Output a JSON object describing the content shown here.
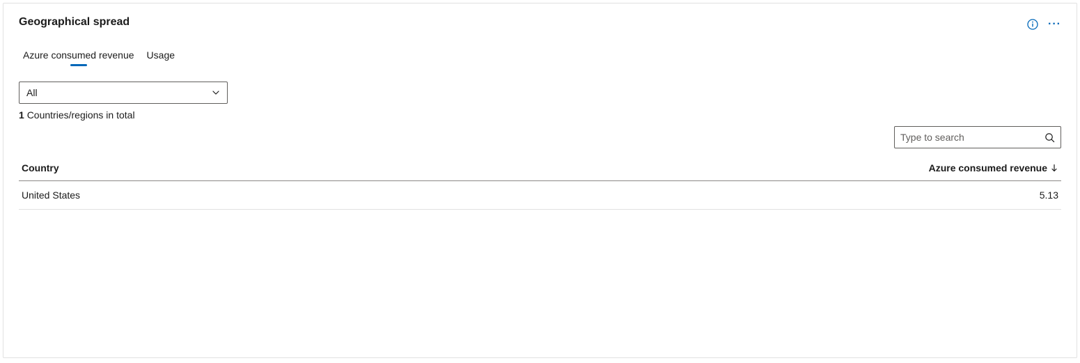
{
  "card": {
    "title": "Geographical spread"
  },
  "tabs": {
    "items": [
      {
        "label": "Azure consumed revenue",
        "active": true
      },
      {
        "label": "Usage",
        "active": false
      }
    ]
  },
  "filter": {
    "selected": "All"
  },
  "summary": {
    "count": "1",
    "label": "Countries/regions in total"
  },
  "search": {
    "placeholder": "Type to search"
  },
  "table": {
    "columns": {
      "country": "Country",
      "revenue": "Azure consumed revenue"
    },
    "rows": [
      {
        "country": "United States",
        "revenue": "5.13"
      }
    ]
  }
}
